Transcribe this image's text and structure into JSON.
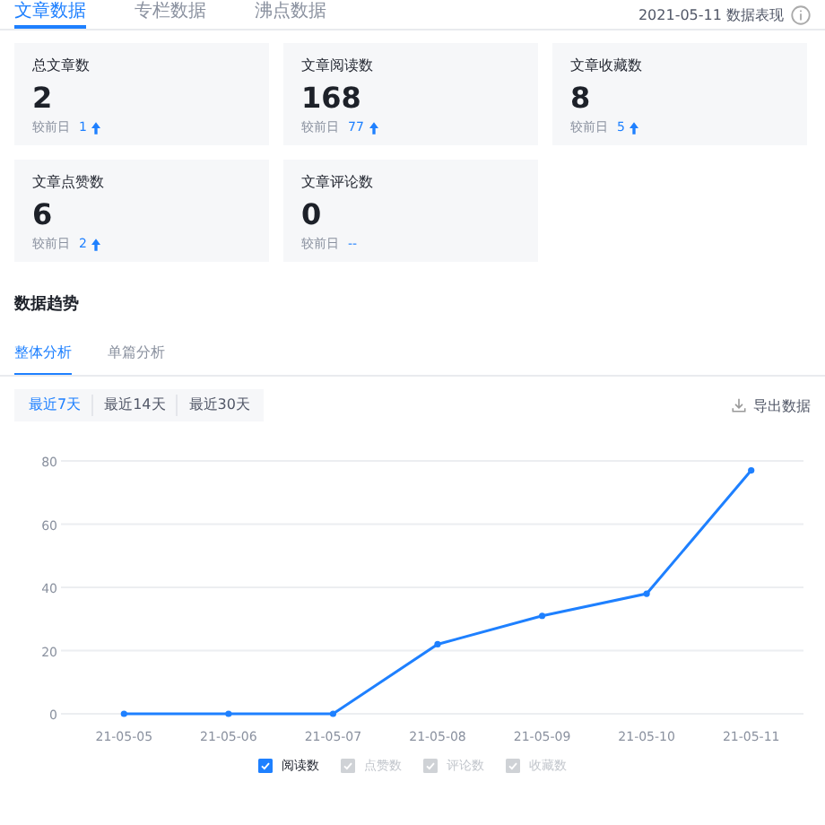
{
  "top_tabs": [
    {
      "label": "文章数据",
      "selected": true
    },
    {
      "label": "专栏数据",
      "selected": false
    },
    {
      "label": "沸点数据",
      "selected": false
    }
  ],
  "report_date": "2021-05-11 数据表现",
  "stats": [
    {
      "title": "总文章数",
      "value": "2",
      "compare_label": "较前日",
      "change": "1",
      "kind": "up"
    },
    {
      "title": "文章阅读数",
      "value": "168",
      "compare_label": "较前日",
      "change": "77",
      "kind": "up"
    },
    {
      "title": "文章收藏数",
      "value": "8",
      "compare_label": "较前日",
      "change": "5",
      "kind": "up"
    },
    {
      "title": "文章点赞数",
      "value": "6",
      "compare_label": "较前日",
      "change": "2",
      "kind": "up"
    },
    {
      "title": "文章评论数",
      "value": "0",
      "compare_label": "较前日",
      "change": "--",
      "kind": "flat"
    }
  ],
  "section_title": "数据趋势",
  "analysis_tabs": [
    {
      "label": "整体分析",
      "selected": true
    },
    {
      "label": "单篇分析",
      "selected": false
    }
  ],
  "ranges": [
    {
      "label": "最近7天",
      "selected": true
    },
    {
      "label": "最近14天",
      "selected": false
    },
    {
      "label": "最近30天",
      "selected": false
    }
  ],
  "export_label": "导出数据",
  "chart_data": {
    "type": "line",
    "categories": [
      "21-05-05",
      "21-05-06",
      "21-05-07",
      "21-05-08",
      "21-05-09",
      "21-05-10",
      "21-05-11"
    ],
    "series": [
      {
        "name": "阅读数",
        "color": "#1e80ff",
        "marker": "circle",
        "values": [
          0,
          0,
          0,
          22,
          31,
          38,
          77
        ]
      }
    ],
    "ylim": [
      0,
      80
    ],
    "yticks": [
      0,
      20,
      40,
      60,
      80
    ],
    "grid": true
  },
  "legend": [
    {
      "checked": true
    },
    {
      "label": "点赞数",
      "checked": false
    },
    {
      "label": "评论数",
      "checked": false
    },
    {
      "label": "收藏数",
      "checked": false
    }
  ]
}
